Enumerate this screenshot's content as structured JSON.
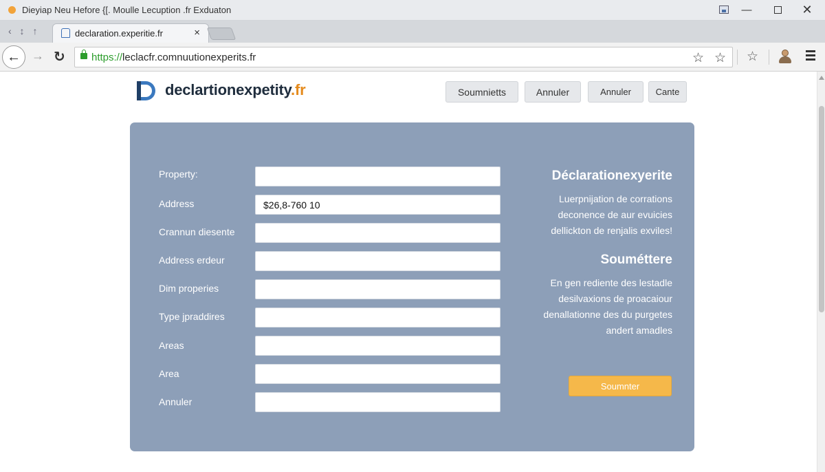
{
  "window": {
    "title": "Dieyiap Neu Hefore {[. Moulle Lecuption .fr Exduaton"
  },
  "tab": {
    "title": "declaration.experitie.fr",
    "close": "×"
  },
  "toolbar": {
    "url_scheme": "https://",
    "url_rest": "leclacfr.comnuutionexperits.fr"
  },
  "site": {
    "logo_text": "declartionexpetity",
    "logo_tld": ".fr"
  },
  "header_buttons": [
    "Soumnietts",
    "Annuler",
    "Annuler",
    "Cante"
  ],
  "form": {
    "fields": [
      {
        "label": "Property:",
        "value": ""
      },
      {
        "label": "Address",
        "value": "$26,8-760 10"
      },
      {
        "label": "Crannun diesente",
        "value": ""
      },
      {
        "label": "Address erdeur",
        "value": ""
      },
      {
        "label": "Dim properies",
        "value": ""
      },
      {
        "label": "Type jpraddires",
        "value": ""
      },
      {
        "label": "Areas",
        "value": ""
      },
      {
        "label": "Area",
        "value": ""
      },
      {
        "label": "Annuler",
        "value": ""
      }
    ]
  },
  "side": {
    "title1": "Déclarationexyerite",
    "para1": [
      "Luerpnijation de corrations",
      "deconence de aur evuicies",
      "dellickton de renjalis exviles!"
    ],
    "title2": "Souméttere",
    "para2": [
      "En gen rediente des lestadle",
      "desilvaxions de proacaiour",
      "denallationne des du purgetes",
      "andert amadles"
    ],
    "submit_label": "Soumnter"
  },
  "colors": {
    "panel": "#8d9fb8",
    "accent": "#f5b84a",
    "logo_blue": "#3b79bf",
    "logo_orange": "#e58b1d"
  }
}
